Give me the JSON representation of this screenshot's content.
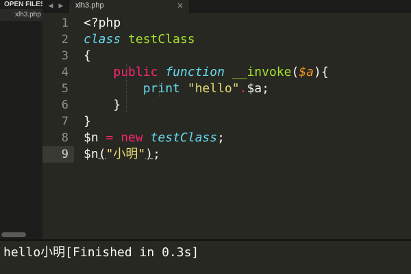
{
  "sidebar": {
    "header": "OPEN FILES",
    "files": [
      "xlh3.php"
    ]
  },
  "tabbar": {
    "back_arrow": "◀",
    "forward_arrow": "▶",
    "tab_title": "xlh3.php",
    "close": "×"
  },
  "editor": {
    "active_line": 9,
    "line_numbers": [
      "1",
      "2",
      "3",
      "4",
      "5",
      "6",
      "7",
      "8",
      "9"
    ],
    "lines": [
      [
        {
          "t": "<?php",
          "c": ""
        }
      ],
      [
        {
          "t": "class",
          "c": "blue-it"
        },
        {
          "t": " ",
          "c": ""
        },
        {
          "t": "testClass",
          "c": "green"
        }
      ],
      [
        {
          "t": "{",
          "c": ""
        }
      ],
      [
        {
          "t": "    ",
          "c": ""
        },
        {
          "t": "public",
          "c": "pink"
        },
        {
          "t": " ",
          "c": ""
        },
        {
          "t": "function",
          "c": "blue-it"
        },
        {
          "t": " ",
          "c": ""
        },
        {
          "t": "__invoke",
          "c": "green"
        },
        {
          "t": "(",
          "c": ""
        },
        {
          "t": "$a",
          "c": "orange-it"
        },
        {
          "t": "){",
          "c": ""
        }
      ],
      [
        {
          "t": "        ",
          "c": ""
        },
        {
          "t": "print",
          "c": "blue"
        },
        {
          "t": " ",
          "c": ""
        },
        {
          "t": "\"hello\"",
          "c": "yellow"
        },
        {
          "t": ".",
          "c": "pink"
        },
        {
          "t": "$a;",
          "c": ""
        }
      ],
      [
        {
          "t": "    }",
          "c": ""
        }
      ],
      [
        {
          "t": "}",
          "c": ""
        }
      ],
      [
        {
          "t": "$n ",
          "c": ""
        },
        {
          "t": "=",
          "c": "pink"
        },
        {
          "t": " ",
          "c": ""
        },
        {
          "t": "new",
          "c": "pink"
        },
        {
          "t": " ",
          "c": ""
        },
        {
          "t": "testClass",
          "c": "blue-it"
        },
        {
          "t": ";",
          "c": ""
        }
      ],
      [
        {
          "t": "$n",
          "c": ""
        },
        {
          "t": "(",
          "c": "ul"
        },
        {
          "t": "\"小明\"",
          "c": "yellow"
        },
        {
          "t": ")",
          "c": "ul"
        },
        {
          "t": ";",
          "c": ""
        }
      ]
    ]
  },
  "output": {
    "text": "hello小明[Finished in 0.3s]"
  },
  "colors": {
    "background": "#272822",
    "keyword": "#f92672",
    "storage": "#66d9ef",
    "entity": "#a6e22e",
    "string": "#e6db74",
    "parameter": "#fd971f"
  }
}
